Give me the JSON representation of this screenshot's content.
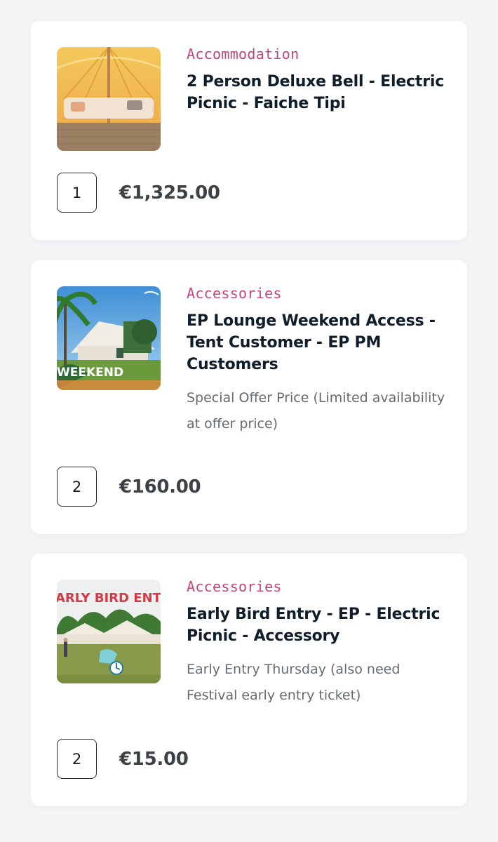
{
  "cart": {
    "items": [
      {
        "category": "Accommodation",
        "title": "2 Person Deluxe Bell - Electric Picnic - Faiche Tipi",
        "description": "",
        "quantity": "1",
        "price": "€1,325.00",
        "image_icon": "bell-tent-interior-image"
      },
      {
        "category": "Accessories",
        "title": "EP Lounge Weekend Access - Tent Customer - EP PM Customers",
        "description": "Special Offer Price (Limited availability at offer price)",
        "quantity": "2",
        "price": "€160.00",
        "image_icon": "lounge-weekend-image",
        "image_text": "WEEKEND"
      },
      {
        "category": "Accessories",
        "title": "Early Bird Entry - EP - Electric Picnic - Accessory",
        "description": "Early Entry Thursday (also need Festival early entry ticket)",
        "quantity": "2",
        "price": "€15.00",
        "image_icon": "early-bird-entry-image",
        "image_text": "ARLY BIRD ENTR"
      }
    ]
  },
  "colors": {
    "category": "#c2457a",
    "title": "#0f1e2a",
    "description": "#646b70",
    "price": "#3c4146",
    "background": "#f3f4f6",
    "card": "#ffffff"
  }
}
